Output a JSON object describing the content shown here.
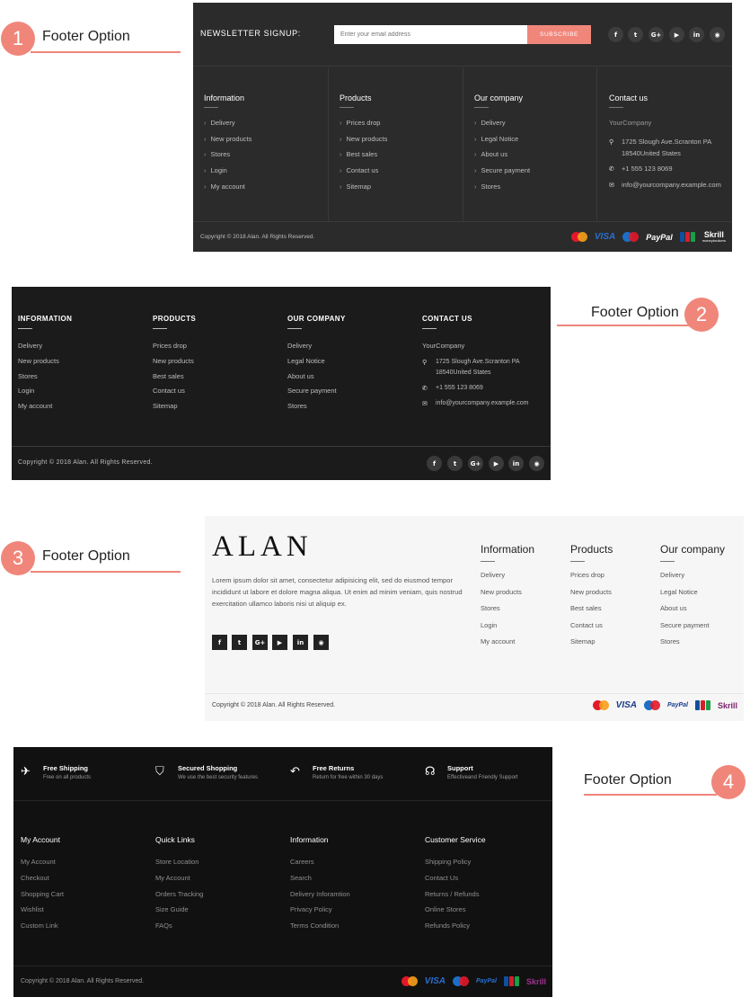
{
  "option_labels": [
    {
      "number": "1",
      "text": "Footer Option"
    },
    {
      "number": "2",
      "text": "Footer Option"
    },
    {
      "number": "3",
      "text": "Footer Option"
    },
    {
      "number": "4",
      "text": "Footer Option"
    }
  ],
  "colors": {
    "accent": "#f0867a",
    "footer1_bg": "#2b2b2b",
    "footer2_bg": "#1b1b1b",
    "footer3_bg": "#f6f6f6",
    "footer4_bg": "#111111"
  },
  "social_icons": [
    "facebook-icon",
    "twitter-icon",
    "google-plus-icon",
    "youtube-icon",
    "linkedin-icon",
    "github-icon"
  ],
  "social_glyphs": [
    "f",
    "t",
    "G+",
    "▶",
    "in",
    "◉"
  ],
  "payments": {
    "visa": "VISA",
    "paypal": "PayPal",
    "skrill": "Skrill",
    "skrill_sub": "moneybookers"
  },
  "footer1": {
    "newsletter_title": "NEWSLETTER SIGNUP:",
    "email_placeholder": "Enter your email address",
    "subscribe_label": "SUBSCRIBE",
    "columns": [
      {
        "title": "Information",
        "items": [
          "Delivery",
          "New products",
          "Stores",
          "Login",
          "My account"
        ]
      },
      {
        "title": "Products",
        "items": [
          "Prices drop",
          "New products",
          "Best sales",
          "Contact us",
          "Sitemap"
        ]
      },
      {
        "title": "Our company",
        "items": [
          "Delivery",
          "Legal Notice",
          "About us",
          "Secure payment",
          "Stores"
        ]
      }
    ],
    "contact": {
      "title": "Contact us",
      "company": "YourCompany",
      "address_line1": "1725 Slough Ave.Scranton PA",
      "address_line2": "18540United States",
      "phone": "+1 555 123 8069",
      "email": "info@yourcompany.example.com"
    },
    "copyright": "Copyright © 2018 Alan. All Rights Reserved."
  },
  "footer2": {
    "columns": [
      {
        "title": "INFORMATION",
        "items": [
          "Delivery",
          "New products",
          "Stores",
          "Login",
          "My account"
        ]
      },
      {
        "title": "PRODUCTS",
        "items": [
          "Prices drop",
          "New products",
          "Best sales",
          "Contact us",
          "Sitemap"
        ]
      },
      {
        "title": "OUR COMPANY",
        "items": [
          "Delivery",
          "Legal Notice",
          "About us",
          "Secure payment",
          "Stores"
        ]
      }
    ],
    "contact": {
      "title": "CONTACT US",
      "company": "YourCompany",
      "address_line1": "1725 Slough Ave.Scranton PA",
      "address_line2": "18540United States",
      "phone": "+1 555 123 8069",
      "email": "info@yourcompany.example.com"
    },
    "copyright": "Copyright © 2018 Alan. All Rights Reserved."
  },
  "footer3": {
    "logo": "ALAN",
    "description": "Lorem ipsum dolor sit amet, consectetur adipisicing elit, sed do eiusmod tempor incididunt ut labore et dolore magna aliqua. Ut enim ad minim veniam, quis nostrud exercitation ullamco laboris nisi ut aliquip ex.",
    "columns": [
      {
        "title": "Information",
        "items": [
          "Delivery",
          "New products",
          "Stores",
          "Login",
          "My account"
        ]
      },
      {
        "title": "Products",
        "items": [
          "Prices drop",
          "New products",
          "Best sales",
          "Contact us",
          "Sitemap"
        ]
      },
      {
        "title": "Our company",
        "items": [
          "Delivery",
          "Legal Notice",
          "About us",
          "Secure payment",
          "Stores"
        ]
      }
    ],
    "copyright": "Copyright © 2018 Alan. All Rights Reserved."
  },
  "footer4": {
    "features": [
      {
        "icon": "airplane-icon",
        "glyph": "✈",
        "title": "Free Shipping",
        "subtitle": "Free on all products"
      },
      {
        "icon": "shield-icon",
        "glyph": "⛉",
        "title": "Secured Shopping",
        "subtitle": "We use the best security features"
      },
      {
        "icon": "return-arrow-icon",
        "glyph": "↶",
        "title": "Free Returns",
        "subtitle": "Return for free within 30 days"
      },
      {
        "icon": "headphones-icon",
        "glyph": "☊",
        "title": "Support",
        "subtitle": "Effectiveand Friendly Support"
      }
    ],
    "columns": [
      {
        "title": "My Account",
        "items": [
          "My Account",
          "Checkout",
          "Shopping Cart",
          "Wishlist",
          "Custom Link"
        ]
      },
      {
        "title": "Quick Links",
        "items": [
          "Store Location",
          "My Account",
          "Orders Tracking",
          "Size Guide",
          "FAQs"
        ]
      },
      {
        "title": "Information",
        "items": [
          "Careers",
          "Search",
          "Delivery Inforamtion",
          "Privacy Policy",
          "Terms Condition"
        ]
      },
      {
        "title": "Customer Service",
        "items": [
          "Shipping Policy",
          "Contact Us",
          "Returns / Refunds",
          "Online Stores",
          "Refunds Policy"
        ]
      }
    ],
    "copyright": "Copyright © 2018 Alan. All Rights Reserved."
  }
}
